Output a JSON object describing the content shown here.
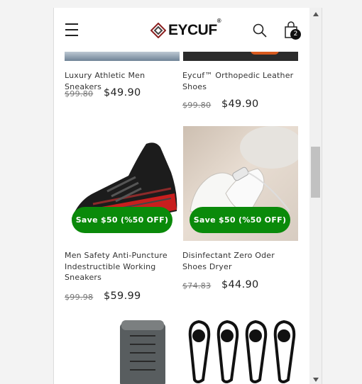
{
  "header": {
    "brand": "EYCUF",
    "brand_mark": "®",
    "cart_count": "2",
    "icons": {
      "menu": "hamburger-menu-icon",
      "search": "search-icon",
      "cart": "shopping-bag-icon"
    }
  },
  "products": [
    {
      "title": "Luxury Athletic Men Sneakers",
      "old_price": "$99.80",
      "price": "$49.90"
    },
    {
      "title": "Eycuf™ Orthopedic Leather Shoes",
      "old_price": "$99.80",
      "price": "$49.90"
    },
    {
      "title": "Men Safety Anti-Puncture Indestructible Working Sneakers",
      "old_price": "$99.98",
      "price": "$59.99",
      "badge": "Save $50 (%50 OFF)"
    },
    {
      "title": "Disinfectant Zero Oder Shoes Dryer",
      "old_price": "$74.83",
      "price": "$44.90",
      "badge": "Save $50 (%50 OFF)"
    }
  ],
  "colors": {
    "sale_badge": "#0a8a0a"
  }
}
